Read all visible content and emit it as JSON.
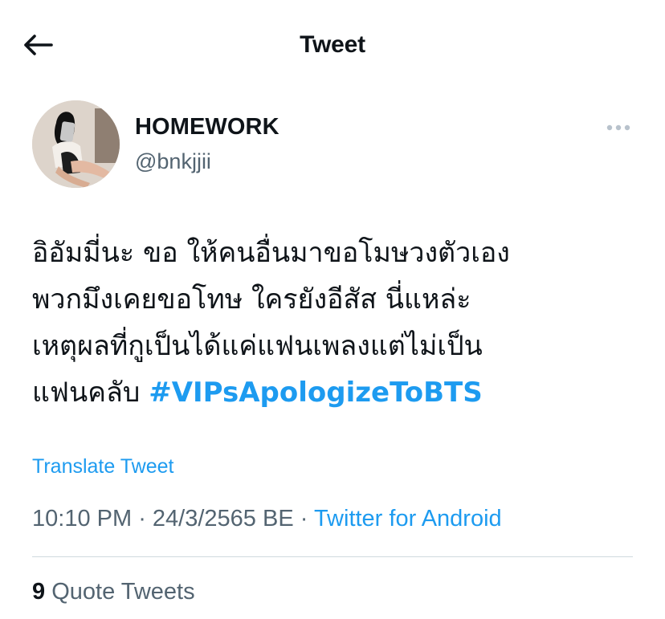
{
  "header": {
    "title": "Tweet",
    "back_icon": "arrow-left-icon"
  },
  "author": {
    "display_name": "HOMEWORK",
    "handle": "@bnkjjii",
    "more_icon": "more-horizontal-icon"
  },
  "tweet": {
    "lines": [
      "อิอัมมี่นะ ขอ ให้คนอื่นมาขอโมษวงตัวเอง",
      "พวกมึงเคยขอโทษ ใครยังอีสัส นี่แหล่ะ",
      "เหตุผลที่กูเป็นได้แค่แฟนเพลงแต่ไม่เป็น",
      "แฟนคลับ "
    ],
    "hashtag": "#VIPsApologizeToBTS",
    "translate_label": "Translate Tweet"
  },
  "meta": {
    "time": "10:10 PM",
    "separator1": " · ",
    "date": "24/3/2565 BE",
    "separator2": " · ",
    "source": "Twitter for Android"
  },
  "stats": {
    "quote_count": "9",
    "quote_label": " Quote Tweets"
  },
  "colors": {
    "accent": "#1d9bf0",
    "text": "#0f1419",
    "secondary": "#536471",
    "divider": "#cfd9de"
  }
}
